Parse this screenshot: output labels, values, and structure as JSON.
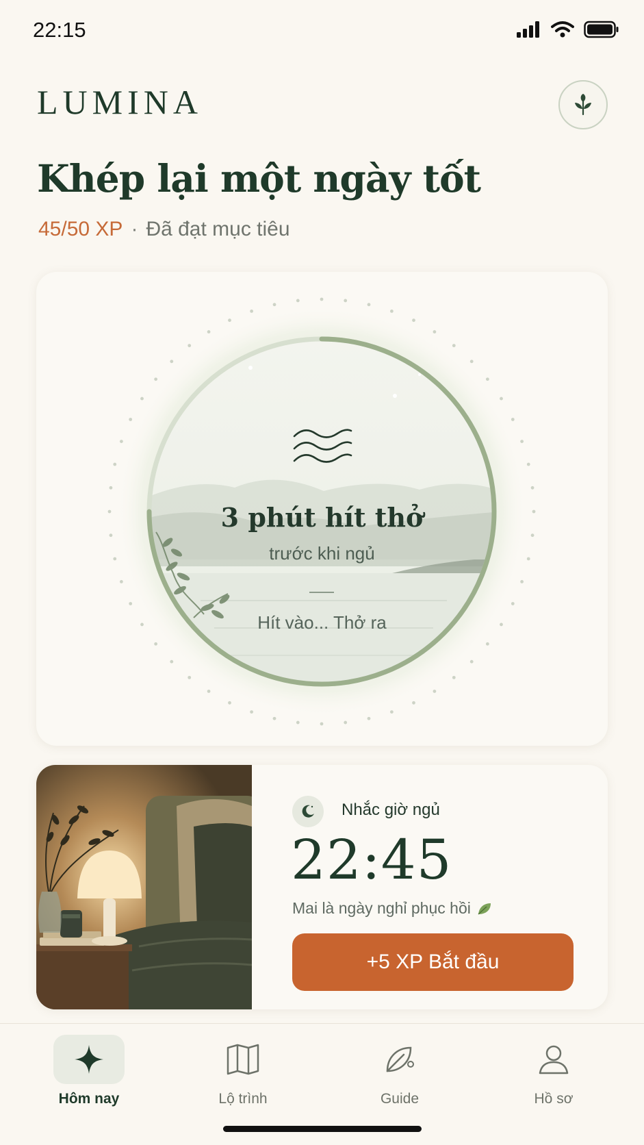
{
  "status_bar": {
    "time": "22:15"
  },
  "header": {
    "brand": "LUMINA",
    "profile_icon": "leaf-icon"
  },
  "greeting": {
    "headline": "Khép lại một ngày tốt",
    "xp_progress": "45/50 XP",
    "separator": "·",
    "goal_status": "Đã đạt mục tiêu"
  },
  "breathing_card": {
    "icon": "wave-icon",
    "title": "3 phút hít thở",
    "subtitle": "trước khi ngủ",
    "hint": "Hít vào... Thở ra",
    "progress_fraction": 0.75
  },
  "reminder_card": {
    "icon": "moon-icon",
    "label": "Nhắc giờ ngủ",
    "time": "22:45",
    "note": "Mai là ngày nghỉ phục hồi",
    "button_label": "+5 XP Bắt đầu"
  },
  "bottom_nav": {
    "items": [
      {
        "label": "Hôm nay",
        "icon": "sparkle-icon",
        "active": true
      },
      {
        "label": "Lộ trình",
        "icon": "map-book-icon",
        "active": false
      },
      {
        "label": "Guide",
        "icon": "leaf-guide-icon",
        "active": false
      },
      {
        "label": "Hồ sơ",
        "icon": "person-icon",
        "active": false
      }
    ]
  },
  "colors": {
    "accent": "#c8642f",
    "primary": "#1f3a2a",
    "sage": "#9caf8c",
    "background": "#faf7f1"
  }
}
